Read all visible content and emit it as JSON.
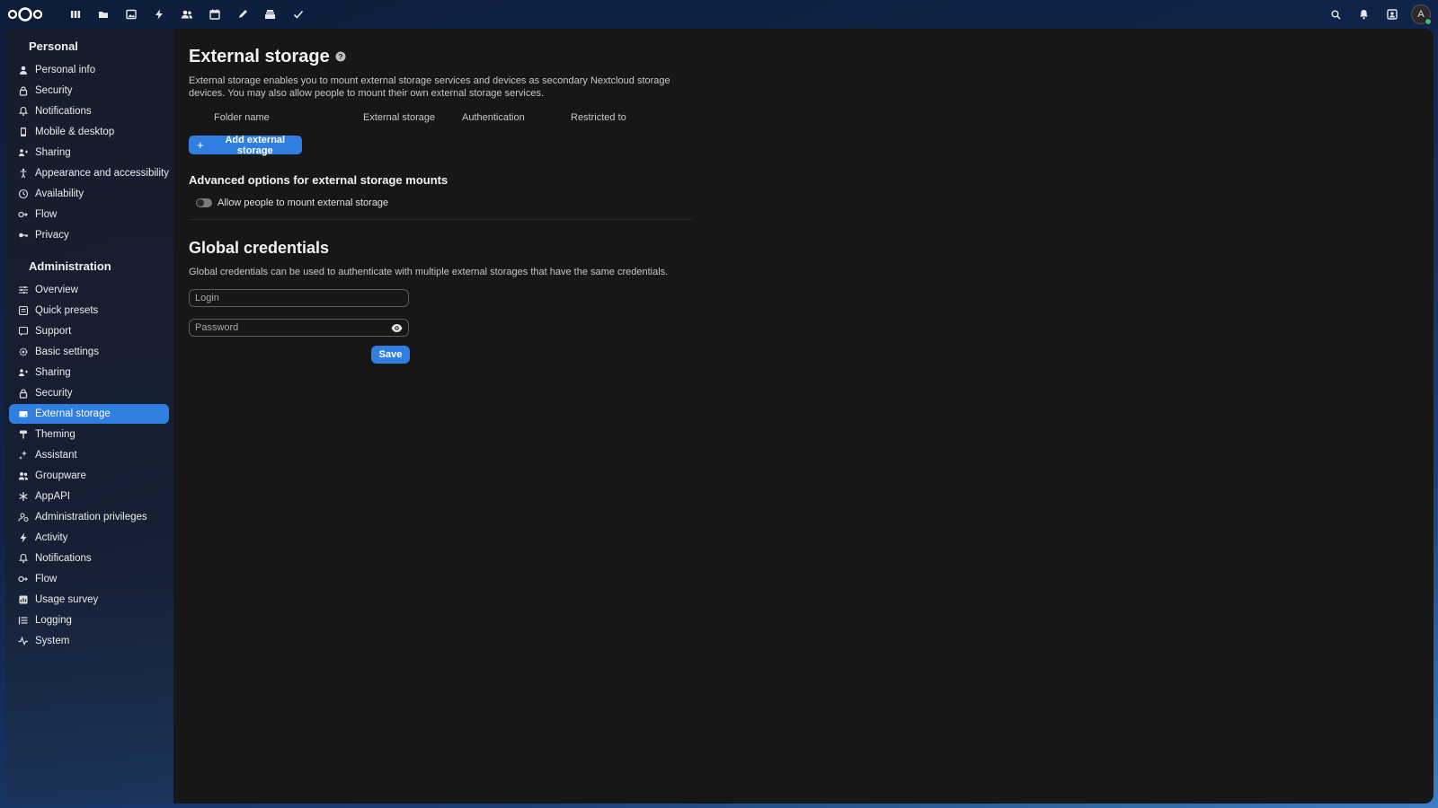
{
  "header": {
    "logo": "nextcloud-logo",
    "apps": [
      {
        "icon": "dashboard-icon",
        "name": "Dashboard"
      },
      {
        "icon": "files-icon",
        "name": "Files"
      },
      {
        "icon": "photos-icon",
        "name": "Photos"
      },
      {
        "icon": "activity-icon",
        "name": "Activity"
      },
      {
        "icon": "contacts-icon",
        "name": "Contacts"
      },
      {
        "icon": "calendar-icon",
        "name": "Calendar"
      },
      {
        "icon": "notes-icon",
        "name": "Notes"
      },
      {
        "icon": "deck-icon",
        "name": "Deck"
      },
      {
        "icon": "tasks-icon",
        "name": "Tasks"
      }
    ],
    "right_icons": [
      "search-icon",
      "notifications-icon",
      "contacts-menu-icon"
    ],
    "avatar_initial": "A",
    "avatar_status_color": "#49b382"
  },
  "sidebar": {
    "personal_title": "Personal",
    "personal_items": [
      {
        "label": "Personal info",
        "icon": "person-icon"
      },
      {
        "label": "Security",
        "icon": "lock-icon"
      },
      {
        "label": "Notifications",
        "icon": "bell-icon"
      },
      {
        "label": "Mobile & desktop",
        "icon": "phone-icon"
      },
      {
        "label": "Sharing",
        "icon": "share-icon"
      },
      {
        "label": "Appearance and accessibility",
        "icon": "accessibility-icon"
      },
      {
        "label": "Availability",
        "icon": "clock-icon"
      },
      {
        "label": "Flow",
        "icon": "flow-icon"
      },
      {
        "label": "Privacy",
        "icon": "key-icon"
      }
    ],
    "admin_title": "Administration",
    "admin_items": [
      {
        "label": "Overview",
        "icon": "sliders-icon"
      },
      {
        "label": "Quick presets",
        "icon": "presets-icon"
      },
      {
        "label": "Support",
        "icon": "support-icon"
      },
      {
        "label": "Basic settings",
        "icon": "gear-icon"
      },
      {
        "label": "Sharing",
        "icon": "share-icon"
      },
      {
        "label": "Security",
        "icon": "lock-icon"
      },
      {
        "label": "External storage",
        "icon": "external-storage-icon",
        "active": true
      },
      {
        "label": "Theming",
        "icon": "brush-icon"
      },
      {
        "label": "Assistant",
        "icon": "sparkle-icon"
      },
      {
        "label": "Groupware",
        "icon": "group-icon"
      },
      {
        "label": "AppAPI",
        "icon": "appapi-icon"
      },
      {
        "label": "Administration privileges",
        "icon": "admin-privileges-icon"
      },
      {
        "label": "Activity",
        "icon": "bolt-icon"
      },
      {
        "label": "Notifications",
        "icon": "bell-icon"
      },
      {
        "label": "Flow",
        "icon": "flow-icon"
      },
      {
        "label": "Usage survey",
        "icon": "chart-icon"
      },
      {
        "label": "Logging",
        "icon": "list-icon"
      },
      {
        "label": "System",
        "icon": "pulse-icon"
      }
    ]
  },
  "main": {
    "title": "External storage",
    "description": "External storage enables you to mount external storage services and devices as secondary Nextcloud storage devices. You may also allow people to mount their own external storage services.",
    "columns": [
      "Folder name",
      "External storage",
      "Authentication",
      "Restricted to"
    ],
    "add_button_label": "Add external storage",
    "advanced_heading": "Advanced options for external storage mounts",
    "allow_mount_label": "Allow people to mount external storage",
    "allow_mount_enabled": false,
    "global_title": "Global credentials",
    "global_description": "Global credentials can be used to authenticate with multiple external storages that have the same credentials.",
    "login_placeholder": "Login",
    "password_placeholder": "Password",
    "save_label": "Save"
  },
  "colors": {
    "accent": "#2f7ee0",
    "content_bg": "#171717"
  }
}
